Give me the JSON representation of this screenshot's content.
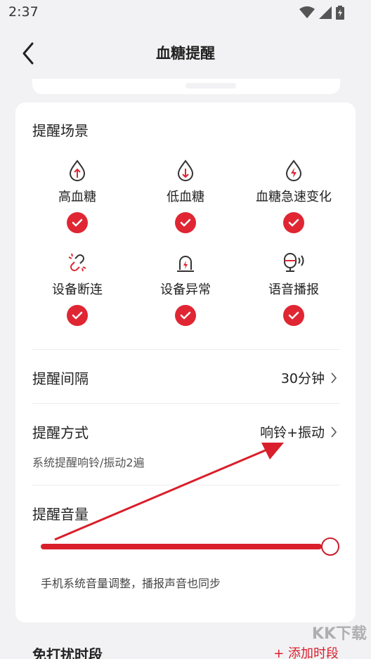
{
  "status_bar": {
    "time": "2:37"
  },
  "nav": {
    "title": "血糖提醒"
  },
  "scene_section": {
    "title": "提醒场景",
    "items": [
      {
        "label": "高血糖",
        "icon": "drop-up-arrow-icon",
        "checked": true
      },
      {
        "label": "低血糖",
        "icon": "drop-down-arrow-icon",
        "checked": true
      },
      {
        "label": "血糖急速变化",
        "icon": "drop-lightning-icon",
        "checked": true
      },
      {
        "label": "设备断连",
        "icon": "broken-link-icon",
        "checked": true
      },
      {
        "label": "设备异常",
        "icon": "alarm-light-icon",
        "checked": true
      },
      {
        "label": "语音播报",
        "icon": "microphone-speaker-icon",
        "checked": true
      }
    ]
  },
  "interval": {
    "label": "提醒间隔",
    "value": "30分钟"
  },
  "method": {
    "label": "提醒方式",
    "value": "响铃+振动",
    "note": "系统提醒响铃/振动2遍"
  },
  "volume": {
    "label": "提醒音量",
    "level_fraction": 1.0,
    "note": "手机系统音量调整，播报声音也同步"
  },
  "dnd": {
    "title": "免打扰时段",
    "add_label": "+ 添加时段"
  },
  "watermark": "KK下载",
  "colors": {
    "accent": "#e02633",
    "background": "#f2f2f4",
    "card": "#ffffff"
  }
}
